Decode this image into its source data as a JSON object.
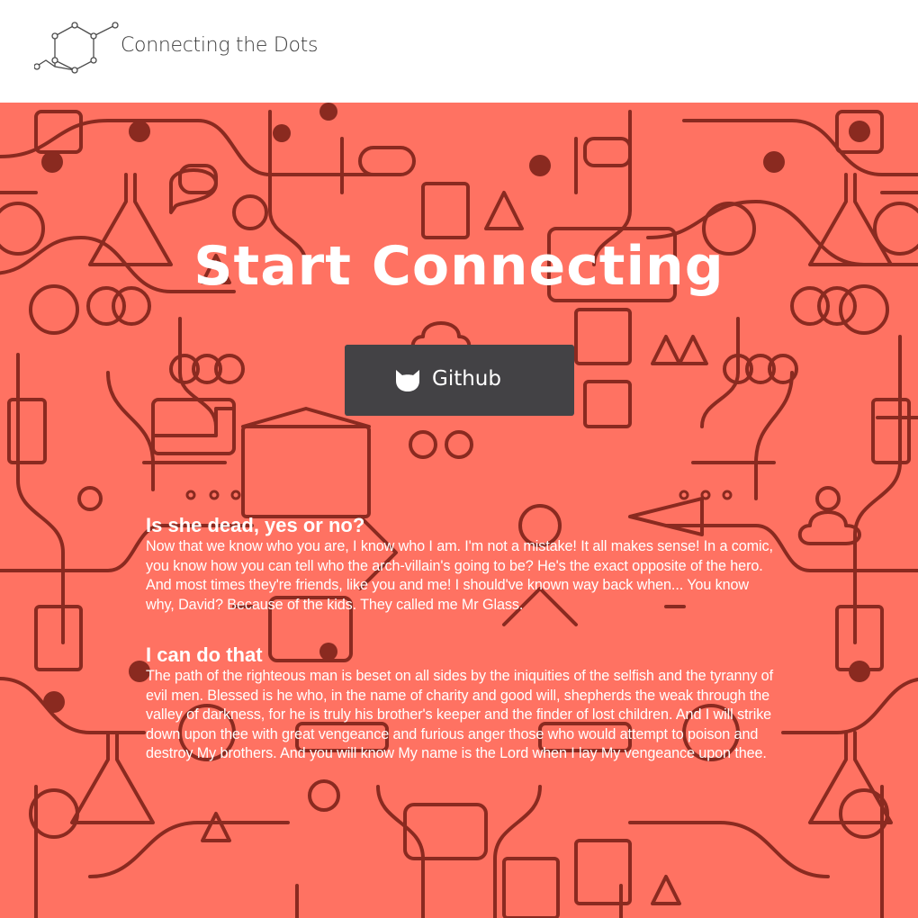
{
  "header": {
    "brand": "Connecting the Dots",
    "logo_icon": "hexagon-dots-logo-icon"
  },
  "hero": {
    "headline": "Start Connecting",
    "button": {
      "label": "Github",
      "icon": "github-cat-icon"
    },
    "background_color": "#ff7262",
    "line_color": "#8a2a20"
  },
  "articles": [
    {
      "title": "Is she dead, yes or no?",
      "body": "Now that we know who you are, I know who I am. I'm not a mistake! It all makes sense! In a comic, you know how you can tell who the arch-villain's going to be? He's the exact opposite of the hero. And most times they're friends, like you and me! I should've known way back when... You know why, David? Because of the kids. They called me Mr Glass."
    },
    {
      "title": "I can do that",
      "body": "The path of the righteous man is beset on all sides by the iniquities of the selfish and the tyranny of evil men. Blessed is he who, in the name of charity and good will, shepherds the weak through the valley of darkness, for he is truly his brother's keeper and the finder of lost children. And I will strike down upon thee with great vengeance and furious anger those who would attempt to poison and destroy My brothers. And you will know My name is the Lord when I lay My vengeance upon thee."
    }
  ]
}
